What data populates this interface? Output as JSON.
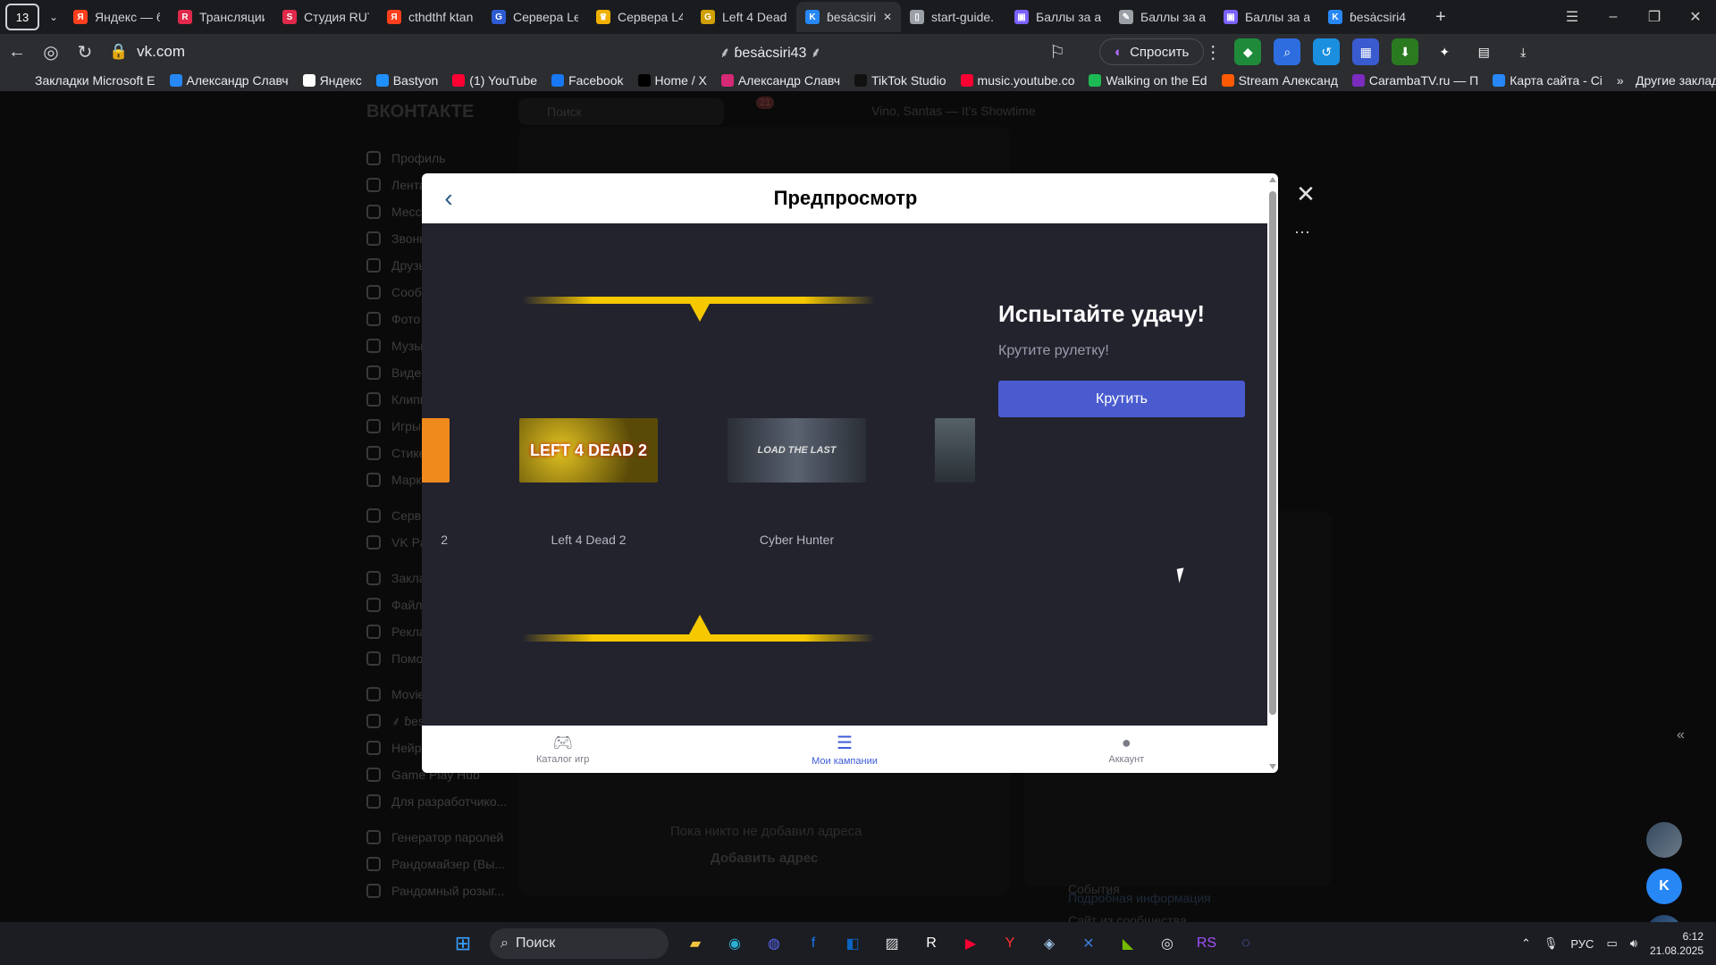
{
  "browser": {
    "tab_count": "13",
    "tabs": [
      {
        "title": "Яндекс — бы",
        "color": "#fc3f1d",
        "glyph": "Я"
      },
      {
        "title": "Трансляции",
        "color": "#e0294a",
        "glyph": "R"
      },
      {
        "title": "Студия RUT",
        "color": "#e0294a",
        "glyph": "S"
      },
      {
        "title": "cthdthf ktan",
        "color": "#fc3f1d",
        "glyph": "Я"
      },
      {
        "title": "Сервера Lef",
        "color": "#2d5bd3",
        "glyph": "G"
      },
      {
        "title": "Сервера L4",
        "color": "#f0b000",
        "glyph": "♛"
      },
      {
        "title": "Left 4 Dead",
        "color": "#d0a000",
        "glyph": "G"
      },
      {
        "title": "ɓesȧcsiri",
        "color": "#2787f5",
        "glyph": "K",
        "active": true
      },
      {
        "title": "start-guide.",
        "color": "#9aa0a6",
        "glyph": "▯"
      },
      {
        "title": "Баллы за ак",
        "color": "#7b61ff",
        "glyph": "▣"
      },
      {
        "title": "Баллы за ак",
        "color": "#9aa0a6",
        "glyph": "✎"
      },
      {
        "title": "Баллы за ак",
        "color": "#7b61ff",
        "glyph": "▣"
      },
      {
        "title": "ɓesȧcsiri4",
        "color": "#2787f5",
        "glyph": "K"
      }
    ],
    "url": "vk.com",
    "page_title": "⸙ ɓesȧcsiri43 ⸙",
    "ask_button": "Спросить",
    "bookmarks": [
      {
        "label": "Закладки Microsoft E",
        "color": "#2b2d31"
      },
      {
        "label": "Александр Славч",
        "color": "#2787f5"
      },
      {
        "label": "Яндекс",
        "color": "#ffffff"
      },
      {
        "label": "Bastyon",
        "color": "#1e90ff"
      },
      {
        "label": "(1) YouTube",
        "color": "#ff0033"
      },
      {
        "label": "Facebook",
        "color": "#1877f2"
      },
      {
        "label": "Home / X",
        "color": "#000000"
      },
      {
        "label": "Александр Славч",
        "color": "#d62976"
      },
      {
        "label": "TikTok Studio",
        "color": "#111111"
      },
      {
        "label": "music.youtube.co",
        "color": "#ff0033"
      },
      {
        "label": "Walking on the Ed",
        "color": "#1db954"
      },
      {
        "label": "Stream Александ",
        "color": "#ff5a00"
      },
      {
        "label": "CarambaTV.ru — П",
        "color": "#7b2cbf"
      },
      {
        "label": "Карта сайта - Ci",
        "color": "#2787f5"
      }
    ],
    "other_bookmarks": "Другие закладки"
  },
  "vk": {
    "logo": "ВКОНТАКТЕ",
    "search_placeholder": "Поиск",
    "notif_count": "21",
    "player_track": "Vino, Santas — It's Showtime",
    "sidebar": [
      "Профиль",
      "Лента",
      "Мессенджер",
      "Звонки",
      "Друзья",
      "Сообщества",
      "Фото",
      "Музыка",
      "Видео",
      "Клипы",
      "Игры",
      "Стикеры",
      "Маркет",
      "Сервисы",
      "VK Pay",
      "Закладки",
      "Файлы",
      "Реклама",
      "Помощь",
      "Movie",
      "⸙ ɓesȧcsiri43 ⸙",
      "Нейросети",
      "Game Play Hub",
      "Для разработчико...",
      "Генератор паролей",
      "Рандомайзер (Вы...",
      "Рандомный розыг..."
    ],
    "empty_text": "Пока никто не добавил адреса",
    "add_address": "Добавить адрес",
    "right_links": [
      "События",
      "Сайт из сообщества",
      "Подробная информация"
    ]
  },
  "modal": {
    "title": "Предпросмотр",
    "promo_title": "Испытайте удачу!",
    "promo_subtitle": "Крутите рулетку!",
    "spin_button": "Крутить",
    "items": [
      {
        "label": "2",
        "art": "",
        "color": "#f08a1c"
      },
      {
        "label": "Left 4 Dead 2",
        "art": "LEFT 4 DEAD 2",
        "color": "#a08a10"
      },
      {
        "label": "Cyber Hunter",
        "art": "LOAD THE LAST",
        "color": "#3a3f4a"
      },
      {
        "label": "",
        "art": "",
        "color": "#4a5560"
      }
    ],
    "nav": [
      {
        "label": "Каталог игр",
        "icon": "gamepad-icon"
      },
      {
        "label": "Мои кампании",
        "icon": "list-icon",
        "active": true
      },
      {
        "label": "Аккаунт",
        "icon": "user-icon"
      }
    ]
  },
  "taskbar": {
    "search": "Поиск",
    "lang": "РУС",
    "time": "6:12",
    "date": "21.08.2025"
  }
}
